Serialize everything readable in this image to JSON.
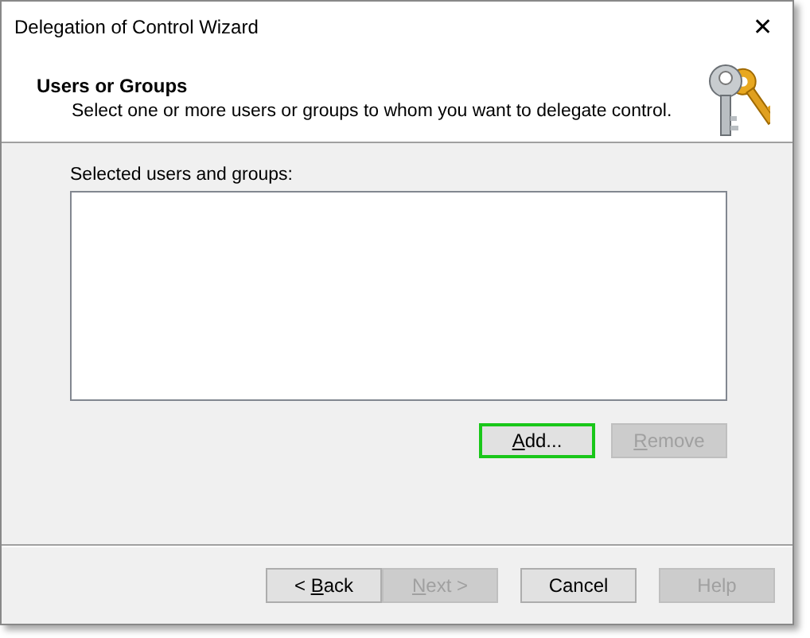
{
  "window": {
    "title": "Delegation of Control Wizard",
    "close": "✕"
  },
  "header": {
    "title": "Users or Groups",
    "subtitle": "Select one or more users or groups to whom you want to delegate control."
  },
  "list": {
    "label": "Selected users and groups:"
  },
  "list_buttons": [
    {
      "access_key": "A",
      "after": "dd...",
      "disabled": false,
      "focused": true
    },
    {
      "access_key": "R",
      "after": "emove",
      "disabled": true,
      "focused": false
    }
  ],
  "footer_buttons": [
    {
      "before": "< ",
      "access_key": "B",
      "after": "ack",
      "disabled": false,
      "focused": false
    },
    {
      "access_key": "N",
      "after": "ext >",
      "disabled": true,
      "focused": false
    },
    {
      "before": "Cancel",
      "disabled": false,
      "focused": false
    },
    {
      "before": "Help",
      "disabled": true,
      "focused": false
    }
  ]
}
